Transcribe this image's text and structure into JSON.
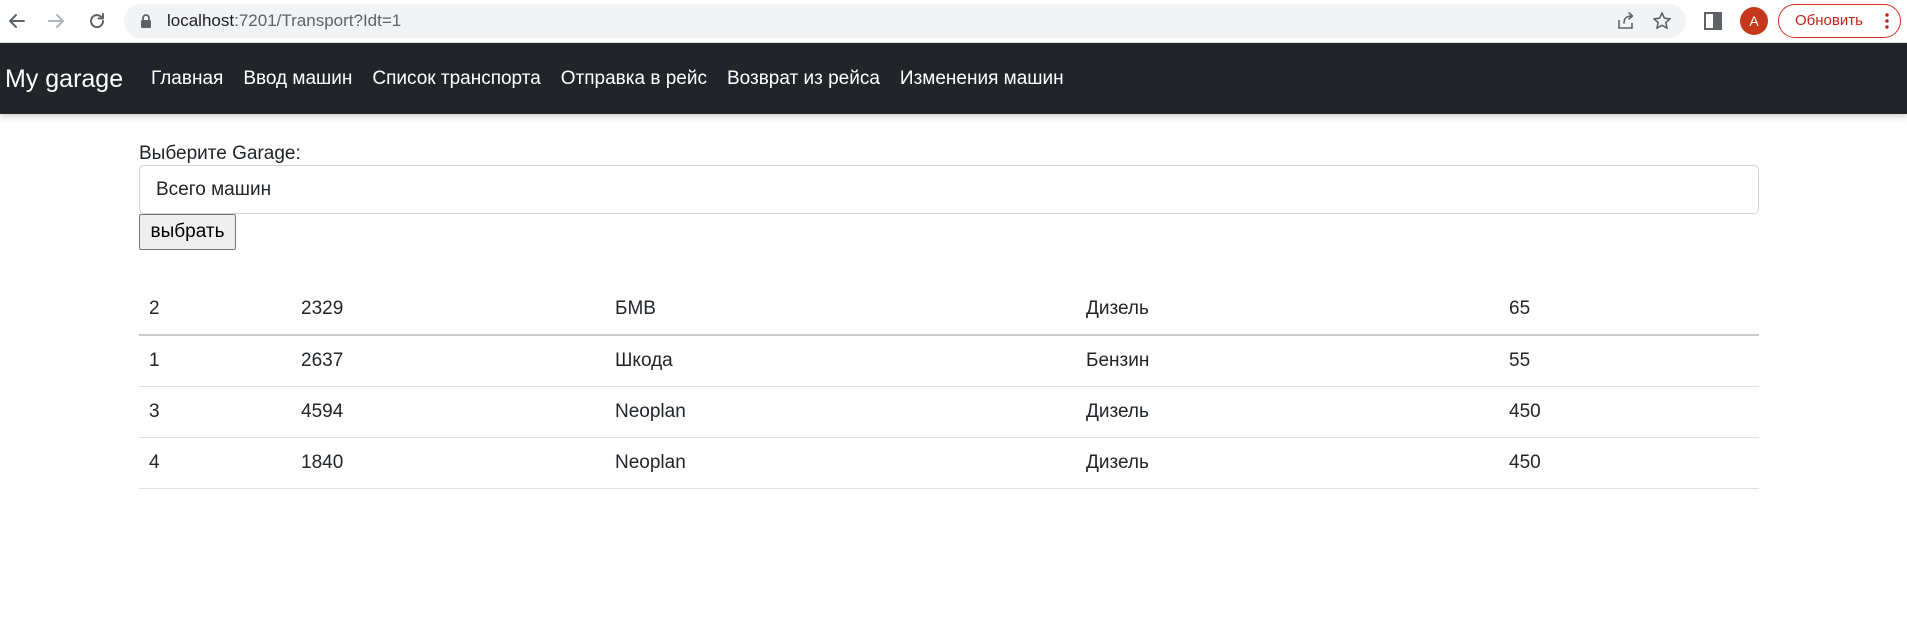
{
  "browser": {
    "url_host": "localhost",
    "url_path": ":7201/Transport?Idt=1",
    "avatar_letter": "A",
    "update_label": "Обновить",
    "accent_color": "#c5221f"
  },
  "navbar": {
    "brand": "My garage",
    "links": [
      {
        "label": "Главная"
      },
      {
        "label": "Ввод машин"
      },
      {
        "label": "Список транспорта"
      },
      {
        "label": "Отправка в рейс"
      },
      {
        "label": "Возврат из рейса"
      },
      {
        "label": "Изменения машин"
      }
    ],
    "background_color": "#212529"
  },
  "form": {
    "label": "Выберите Garage:",
    "selected_value": "Всего машин",
    "submit_label": "выбрать"
  },
  "table": {
    "rows": [
      [
        "2",
        "2329",
        "БМВ",
        "Дизель",
        "65"
      ],
      [
        "1",
        "2637",
        "Шкода",
        "Бензин",
        "55"
      ],
      [
        "3",
        "4594",
        "Neoplan",
        "Дизель",
        "450"
      ],
      [
        "4",
        "1840",
        "Neoplan",
        "Дизель",
        "450"
      ]
    ]
  }
}
